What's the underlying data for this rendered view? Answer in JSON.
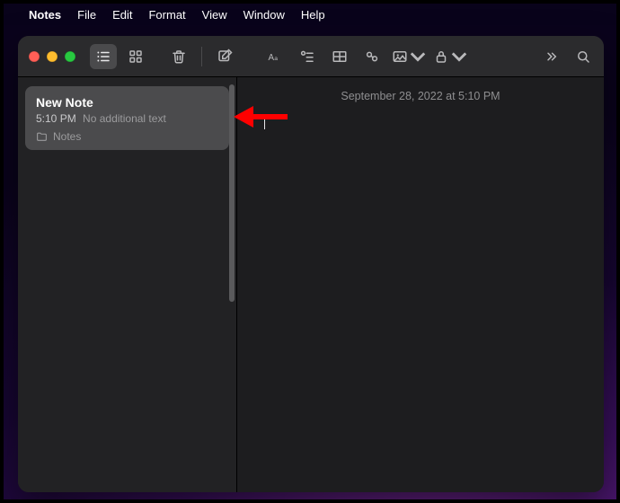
{
  "menubar": {
    "app": "Notes",
    "items": [
      "File",
      "Edit",
      "Format",
      "View",
      "Window",
      "Help"
    ]
  },
  "toolbar": {
    "list_view": "list-view-icon",
    "grid_view": "grid-view-icon",
    "trash": "trash-icon",
    "compose": "compose-icon",
    "format": "format-text-icon",
    "checklist": "checklist-icon",
    "table": "table-icon",
    "link": "link-icon",
    "media": "media-icon",
    "lock": "lock-icon",
    "overflow": "overflow-icon",
    "search": "search-icon"
  },
  "sidebar": {
    "items": [
      {
        "title": "New Note",
        "time": "5:10 PM",
        "preview": "No additional text",
        "folder": "Notes"
      }
    ]
  },
  "editor": {
    "date_header": "September 28, 2022 at 5:10 PM"
  }
}
